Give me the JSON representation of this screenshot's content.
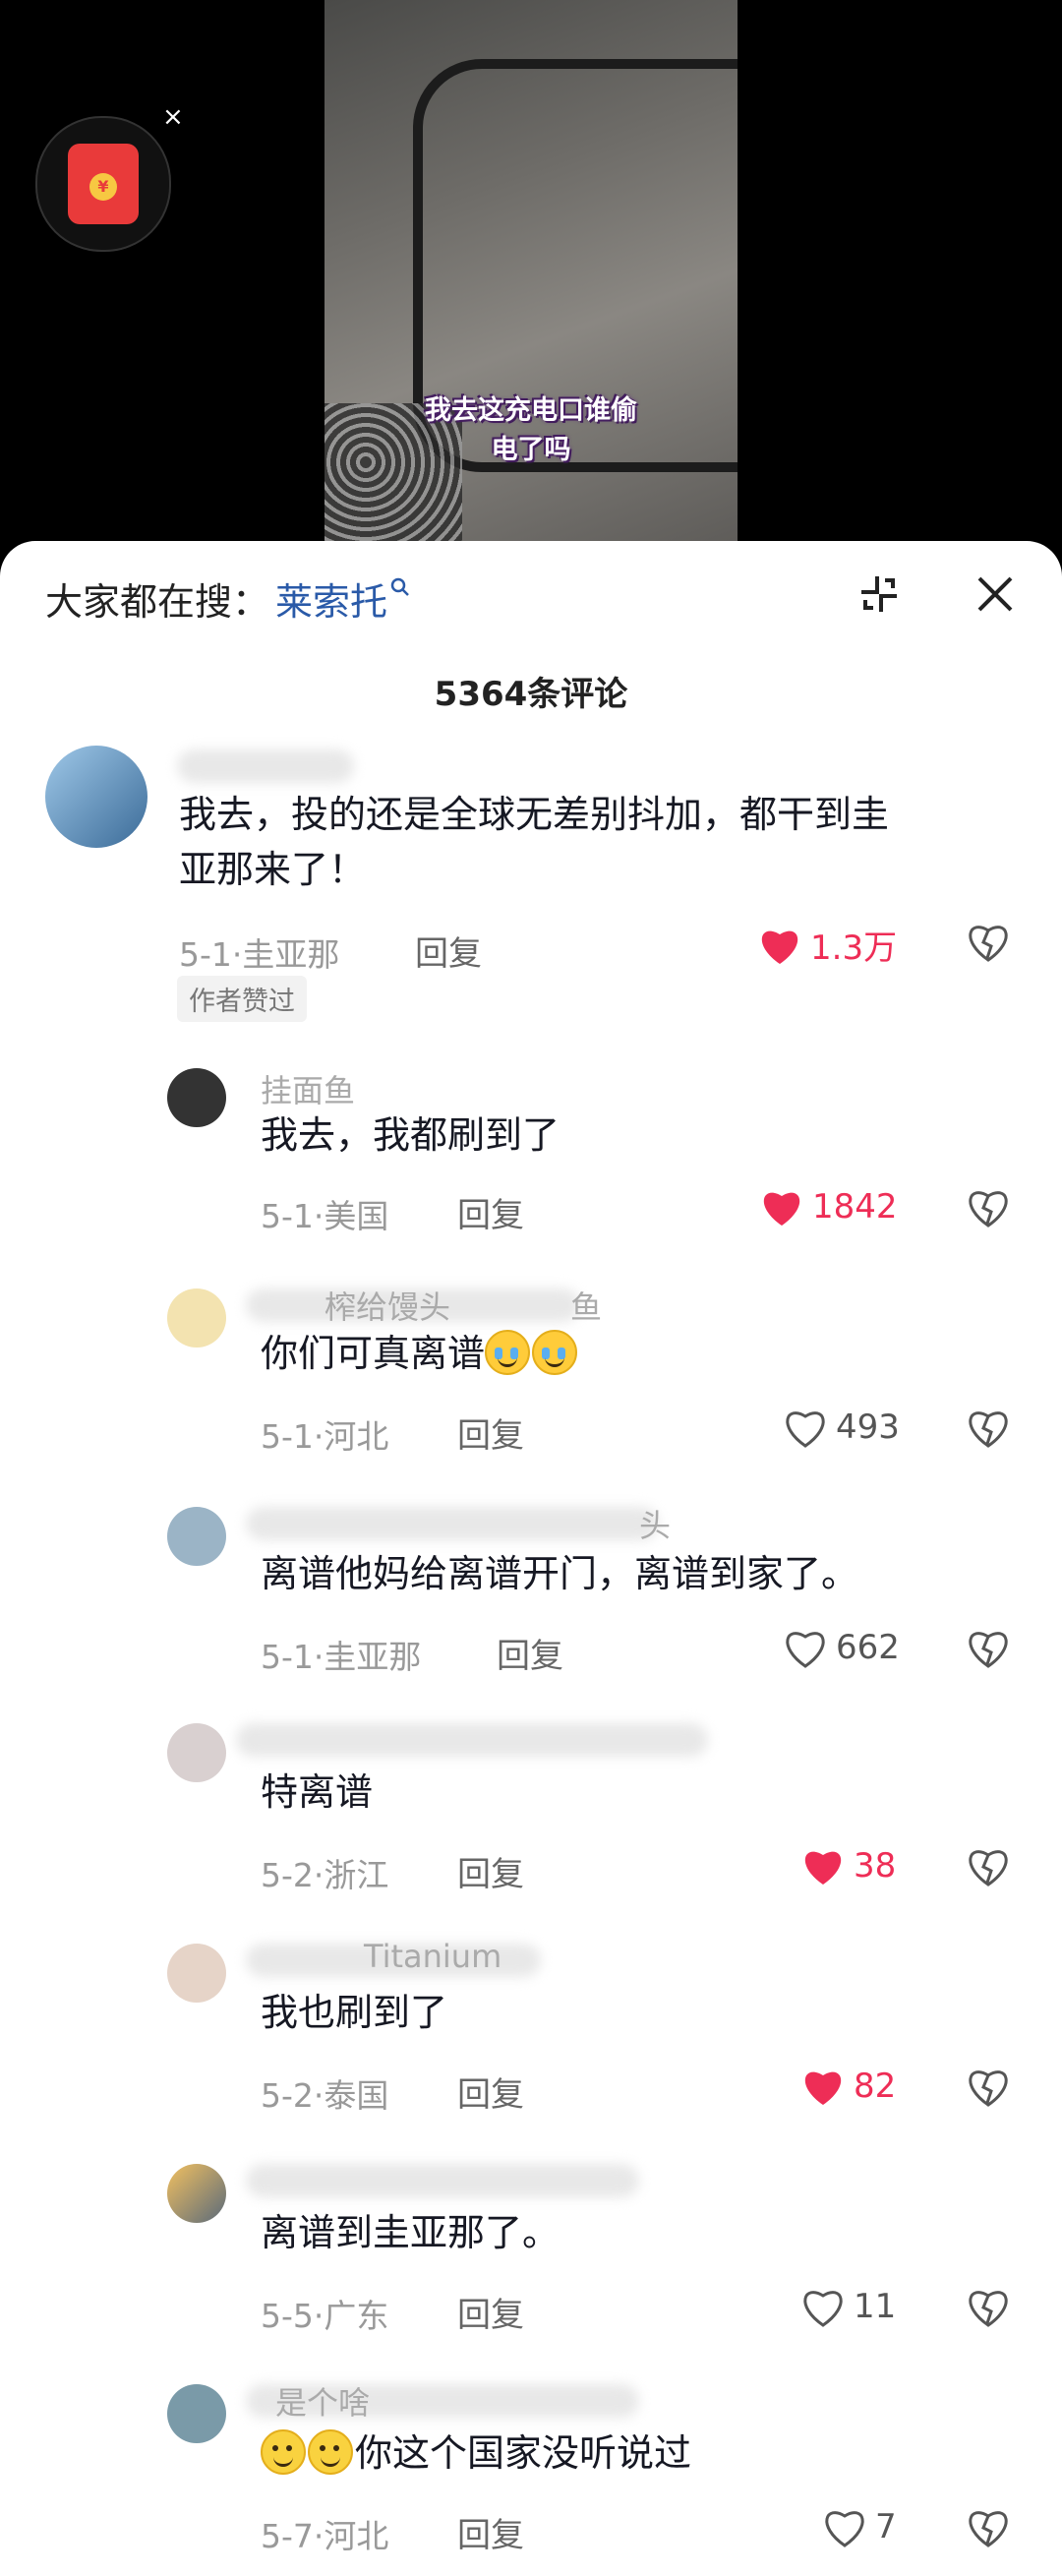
{
  "video": {
    "caption_line1": "我去这充电口谁偷",
    "caption_line2": "电了吗",
    "close_glyph": "×"
  },
  "search": {
    "prefix": "大家都在搜：",
    "keyword": "莱索托"
  },
  "comment_count": "5364条评论",
  "comments": [
    {
      "name": "",
      "text1": "我去，投的还是全球无差别抖加，都干到圭",
      "text2": "亚那来了！",
      "meta": "5-1·圭亚那",
      "reply": "回复",
      "likes": "1.3万",
      "liked": true,
      "badge": "作者赞过"
    },
    {
      "name": "挂面鱼",
      "text1": "我去，我都刷到了",
      "meta": "5-1·美国",
      "reply": "回复",
      "likes": "1842",
      "liked": true
    },
    {
      "name": "榨给馒头",
      "name_tail": "鱼",
      "text1": "你们可真离谱",
      "meta": "5-1·河北",
      "reply": "回复",
      "likes": "493",
      "liked": false
    },
    {
      "name": "",
      "name_tail": "头",
      "text1": "离谱他妈给离谱开门，离谱到家了。",
      "meta": "5-1·圭亚那",
      "reply": "回复",
      "likes": "662",
      "liked": false
    },
    {
      "name": "",
      "text1": "特离谱",
      "meta": "5-2·浙江",
      "reply": "回复",
      "likes": "38",
      "liked": true
    },
    {
      "name": "",
      "name_tail": "Titanium",
      "text1": "我也刷到了",
      "meta": "5-2·泰国",
      "reply": "回复",
      "likes": "82",
      "liked": true
    },
    {
      "name": "",
      "text1": "离谱到圭亚那了。",
      "meta": "5-5·广东",
      "reply": "回复",
      "likes": "11",
      "liked": false
    },
    {
      "name": "是个啥",
      "text1": "你这个国家没听说过",
      "meta": "5-7·河北",
      "reply": "回复",
      "likes": "7",
      "liked": false
    }
  ],
  "colors": {
    "accent_red": "#ee2d56",
    "search_blue": "#2a5aa8"
  },
  "icons": [
    "red-packet-icon",
    "search-icon",
    "collapse-icon",
    "close-icon",
    "heart-icon",
    "broken-heart-icon",
    "smile-emoji",
    "cry-laugh-emoji"
  ]
}
